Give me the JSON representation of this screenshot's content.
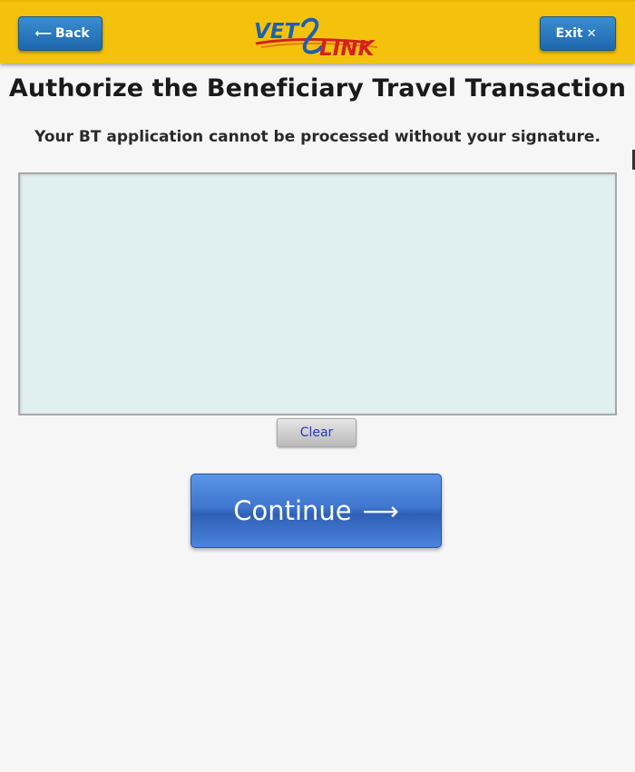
{
  "header": {
    "back_label": "Back",
    "back_icon": "left-arrow-icon",
    "exit_label": "Exit",
    "exit_icon": "close-icon",
    "logo": {
      "part1": "VET",
      "part2": "LINK"
    },
    "background_color": "#f4c20d",
    "button_color": "#1d66ad"
  },
  "main": {
    "title": "Authorize the Beneficiary Travel Transaction",
    "subtitle": "Your BT application cannot be processed without your signature.",
    "signature_pad_color": "#e0efef",
    "clear_label": "Clear",
    "continue_label": "Continue",
    "continue_icon": "right-arrow-icon",
    "continue_color": "#3f76cf"
  }
}
